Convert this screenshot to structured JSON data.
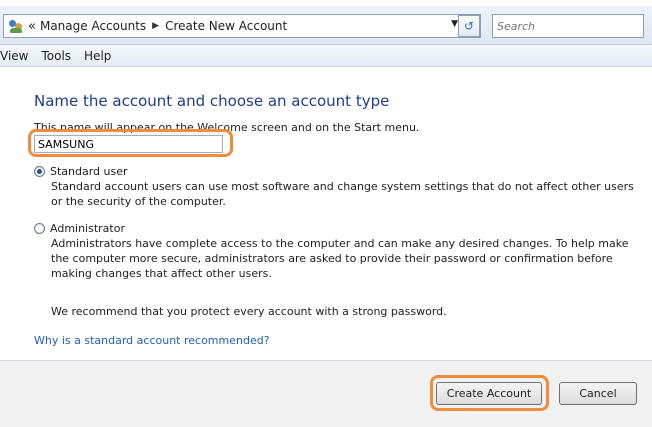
{
  "addressbar": {
    "back_glyph": "«",
    "breadcrumb": [
      "Manage Accounts",
      "Create New Account"
    ],
    "search_placeholder": "Search"
  },
  "menu": {
    "items": [
      "View",
      "Tools",
      "Help"
    ]
  },
  "main": {
    "heading": "Name the account and choose an account type",
    "description": "This name will appear on the Welcome screen and on the Start menu.",
    "account_name_value": "SAMSUNG",
    "options": [
      {
        "label": "Standard user",
        "checked": true,
        "description": "Standard account users can use most software and change system settings that do not affect other users or the security of the computer."
      },
      {
        "label": "Administrator",
        "checked": false,
        "description": "Administrators have complete access to the computer and can make any desired changes. To help make the computer more secure, administrators are asked to provide their password or confirmation before making changes that affect other users."
      }
    ],
    "recommendation": "We recommend that you protect every account with a strong password.",
    "help_link": "Why is a standard account recommended?"
  },
  "footer": {
    "create_label": "Create Account",
    "cancel_label": "Cancel"
  },
  "colors": {
    "heading": "#1e3c8a",
    "link": "#1f5fb8",
    "highlight": "#f08c3c"
  }
}
